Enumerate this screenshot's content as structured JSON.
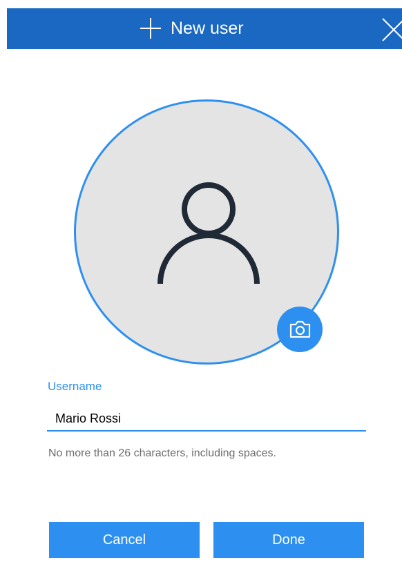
{
  "dialog": {
    "title": "New user",
    "title_icon": "plus-icon",
    "close_icon": "close-icon"
  },
  "avatar": {
    "placeholder_icon": "person-icon",
    "camera_icon": "camera-icon"
  },
  "username": {
    "label": "Username",
    "value": "Mario Rossi",
    "helper": "No more than 26 characters, including spaces."
  },
  "actions": {
    "cancel_label": "Cancel",
    "done_label": "Done"
  },
  "colors": {
    "title_bar": "#1a68c1",
    "accent": "#2d8ff0",
    "avatar_fill": "#e5e4e4",
    "person_stroke": "#1f2a36",
    "helper_text": "#6c6c6c"
  }
}
